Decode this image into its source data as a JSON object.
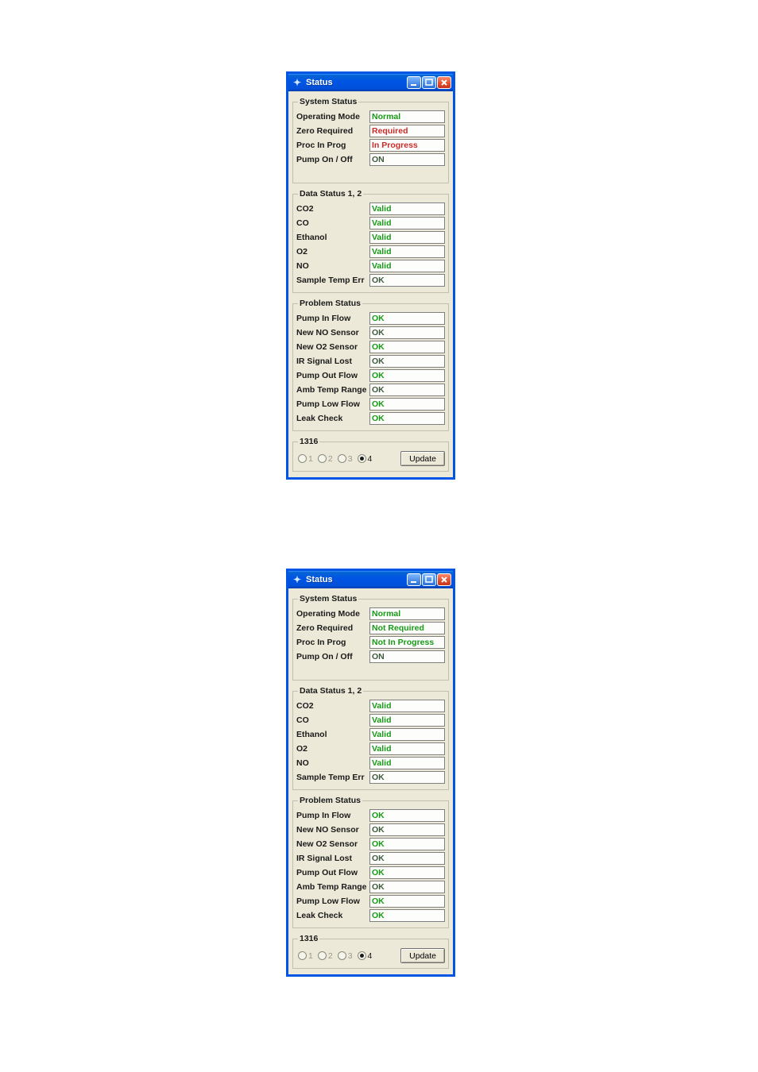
{
  "colors": {
    "ok_green": "#159a15",
    "warn_red": "#cc2a2a",
    "muted_green": "#3d5a3d"
  },
  "windows": [
    {
      "title": "Status",
      "system_status": {
        "legend": "System Status",
        "rows": [
          {
            "label": "Operating Mode",
            "value": "Normal",
            "cls": "green"
          },
          {
            "label": "Zero Required",
            "value": "Required",
            "cls": "red"
          },
          {
            "label": "Proc In Prog",
            "value": "In Progress",
            "cls": "red"
          },
          {
            "label": "Pump On / Off",
            "value": "ON",
            "cls": "darkgr"
          }
        ]
      },
      "data_status": {
        "legend": "Data Status 1, 2",
        "rows": [
          {
            "label": "CO2",
            "value": "Valid",
            "cls": "green"
          },
          {
            "label": "CO",
            "value": "Valid",
            "cls": "green"
          },
          {
            "label": "Ethanol",
            "value": "Valid",
            "cls": "green"
          },
          {
            "label": "O2",
            "value": "Valid",
            "cls": "green"
          },
          {
            "label": "NO",
            "value": "Valid",
            "cls": "green"
          },
          {
            "label": "Sample Temp Err",
            "value": "OK",
            "cls": "darkgr"
          }
        ]
      },
      "problem_status": {
        "legend": "Problem Status",
        "rows": [
          {
            "label": "Pump In Flow",
            "value": "OK",
            "cls": "green"
          },
          {
            "label": "New NO Sensor",
            "value": "OK",
            "cls": "darkgr"
          },
          {
            "label": "New O2 Sensor",
            "value": "OK",
            "cls": "green"
          },
          {
            "label": "IR Signal Lost",
            "value": "OK",
            "cls": "darkgr"
          },
          {
            "label": "Pump Out Flow",
            "value": "OK",
            "cls": "green"
          },
          {
            "label": "Amb Temp Range",
            "value": "OK",
            "cls": "darkgr"
          },
          {
            "label": "Pump Low Flow",
            "value": "OK",
            "cls": "green"
          },
          {
            "label": "Leak Check",
            "value": "OK",
            "cls": "green"
          }
        ]
      },
      "footer": {
        "legend": "1316",
        "options": [
          "1",
          "2",
          "3",
          "4"
        ],
        "selected": "4",
        "button": "Update"
      }
    },
    {
      "title": "Status",
      "system_status": {
        "legend": "System Status",
        "rows": [
          {
            "label": "Operating Mode",
            "value": "Normal",
            "cls": "green"
          },
          {
            "label": "Zero Required",
            "value": "Not Required",
            "cls": "green"
          },
          {
            "label": "Proc In Prog",
            "value": "Not In Progress",
            "cls": "green"
          },
          {
            "label": "Pump On / Off",
            "value": "ON",
            "cls": "darkgr"
          }
        ]
      },
      "data_status": {
        "legend": "Data Status 1, 2",
        "rows": [
          {
            "label": "CO2",
            "value": "Valid",
            "cls": "green"
          },
          {
            "label": "CO",
            "value": "Valid",
            "cls": "green"
          },
          {
            "label": "Ethanol",
            "value": "Valid",
            "cls": "green"
          },
          {
            "label": "O2",
            "value": "Valid",
            "cls": "green"
          },
          {
            "label": "NO",
            "value": "Valid",
            "cls": "green"
          },
          {
            "label": "Sample Temp Err",
            "value": "OK",
            "cls": "darkgr"
          }
        ]
      },
      "problem_status": {
        "legend": "Problem Status",
        "rows": [
          {
            "label": "Pump In Flow",
            "value": "OK",
            "cls": "green"
          },
          {
            "label": "New NO Sensor",
            "value": "OK",
            "cls": "darkgr"
          },
          {
            "label": "New O2 Sensor",
            "value": "OK",
            "cls": "green"
          },
          {
            "label": "IR Signal Lost",
            "value": "OK",
            "cls": "darkgr"
          },
          {
            "label": "Pump Out Flow",
            "value": "OK",
            "cls": "green"
          },
          {
            "label": "Amb Temp Range",
            "value": "OK",
            "cls": "darkgr"
          },
          {
            "label": "Pump Low Flow",
            "value": "OK",
            "cls": "green"
          },
          {
            "label": "Leak Check",
            "value": "OK",
            "cls": "green"
          }
        ]
      },
      "footer": {
        "legend": "1316",
        "options": [
          "1",
          "2",
          "3",
          "4"
        ],
        "selected": "4",
        "button": "Update"
      }
    }
  ]
}
